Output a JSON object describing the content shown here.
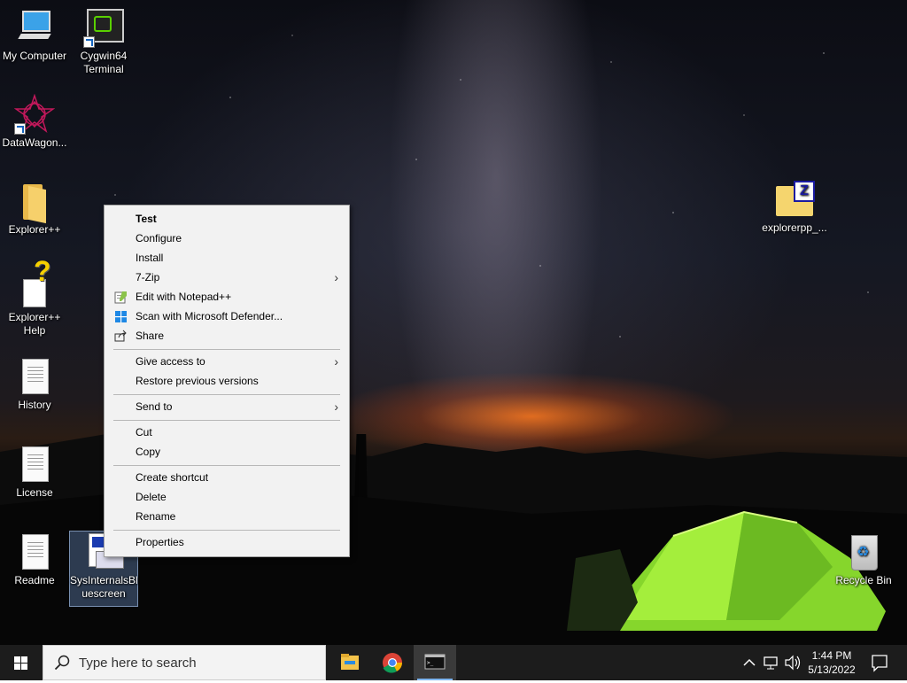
{
  "desktop_icons": [
    {
      "label": "My Computer"
    },
    {
      "label": "Cygwin64\nTerminal"
    },
    {
      "label": "DataWagon..."
    },
    {
      "label": "Explorer++"
    },
    {
      "label": "Explorer++\nHelp"
    },
    {
      "label": "History"
    },
    {
      "label": "License"
    },
    {
      "label": "Readme"
    },
    {
      "label": "SysInternalsBl\nuescreen"
    },
    {
      "label": "explorerpp_..."
    },
    {
      "label": "Recycle Bin"
    }
  ],
  "context_menu": {
    "items": [
      {
        "label": "Test"
      },
      {
        "label": "Configure"
      },
      {
        "label": "Install"
      },
      {
        "label": "7-Zip"
      },
      {
        "label": "Edit with Notepad++"
      },
      {
        "label": "Scan with Microsoft Defender..."
      },
      {
        "label": "Share"
      },
      {
        "label": "Give access to"
      },
      {
        "label": "Restore previous versions"
      },
      {
        "label": "Send to"
      },
      {
        "label": "Cut"
      },
      {
        "label": "Copy"
      },
      {
        "label": "Create shortcut"
      },
      {
        "label": "Delete"
      },
      {
        "label": "Rename"
      },
      {
        "label": "Properties"
      }
    ]
  },
  "taskbar": {
    "search_placeholder": "Type here to search",
    "time": "1:44 PM",
    "date": "5/13/2022"
  },
  "colors": {
    "taskbar": "#1c1c1c",
    "menu_bg": "#f2f2f2",
    "windows_blue": "#0078d7"
  }
}
